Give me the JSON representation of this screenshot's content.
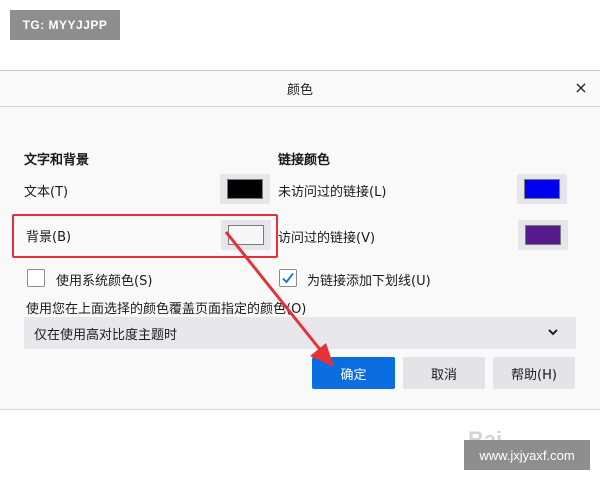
{
  "overlay": {
    "top_badge": "TG: MYYJJPP",
    "bottom_badge": "www.jxjyaxf.com",
    "watermark": "Bai"
  },
  "dialog": {
    "title": "颜色",
    "close": "×",
    "text_background": {
      "heading": "文字和背景",
      "text_label": "文本(T)",
      "text_color": "#000000",
      "background_label": "背景(B)",
      "background_color": "#f7f7f7"
    },
    "link_colors": {
      "heading": "链接颜色",
      "unvisited_label": "未访问过的链接(L)",
      "unvisited_color": "#0000ee",
      "visited_label": "访问过的链接(V)",
      "visited_color": "#551a8b"
    },
    "use_system_colors": {
      "label": "使用系统颜色(S)",
      "checked": false
    },
    "underline_links": {
      "label": "为链接添加下划线(U)",
      "checked": true
    },
    "override_label": "使用您在上面选择的颜色覆盖页面指定的颜色(O)",
    "override_value": "仅在使用高对比度主题时",
    "buttons": {
      "ok": "确定",
      "cancel": "取消",
      "help": "帮助(H)"
    }
  },
  "colors": {
    "accent": "#0a6ee0",
    "highlight_red": "#e5313a"
  }
}
